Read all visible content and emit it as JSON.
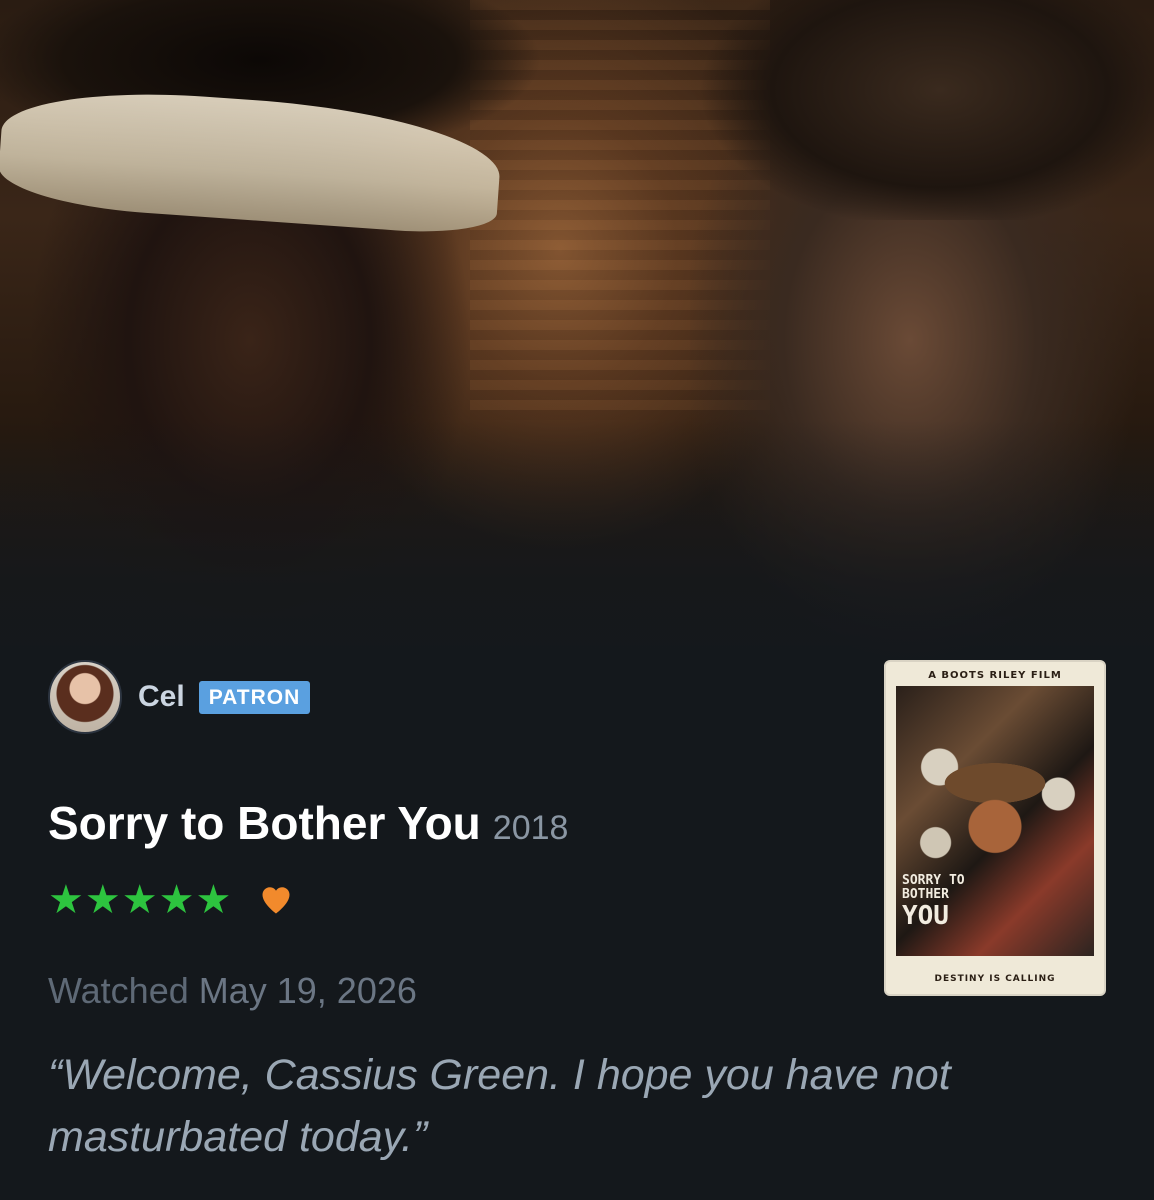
{
  "review": {
    "user": {
      "name": "Cel",
      "badge": "PATRON"
    },
    "film": {
      "title": "Sorry to Bother You",
      "year": "2018"
    },
    "rating": {
      "stars": 5,
      "max": 5,
      "liked": true
    },
    "watched": {
      "label": "Watched",
      "date": "May 19, 2026"
    },
    "text": "“Welcome, Cassius Green. I hope you have not masturbated today.”"
  },
  "poster": {
    "banner": "A BOOTS RILEY FILM",
    "title_lines": [
      "SORRY TO",
      "BOTHER",
      "YOU"
    ],
    "tagline": "DESTINY IS CALLING"
  },
  "colors": {
    "star": "#2dc43f",
    "heart": "#f28a2c",
    "badge": "#5aa0e0",
    "background": "#14181c"
  },
  "icons": {
    "star": "star-icon",
    "heart": "heart-icon"
  }
}
